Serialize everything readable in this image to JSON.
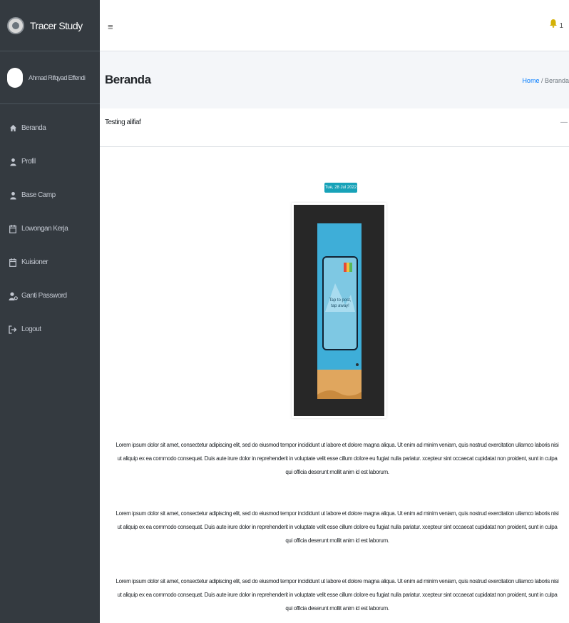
{
  "brand": {
    "name": "Tracer Study"
  },
  "user": {
    "name": "Ahmad Rifqyad Effendi"
  },
  "sidebar": {
    "items": [
      {
        "label": "Beranda",
        "icon": "home-icon"
      },
      {
        "label": "Profil",
        "icon": "user-icon"
      },
      {
        "label": "Base Camp",
        "icon": "user-icon"
      },
      {
        "label": "Lowongan Kerja",
        "icon": "calendar-icon"
      },
      {
        "label": "Kuisioner",
        "icon": "calendar-icon"
      },
      {
        "label": "Ganti Password",
        "icon": "user-cog-icon"
      },
      {
        "label": "Logout",
        "icon": "logout-icon"
      }
    ]
  },
  "topbar": {
    "menu_icon": "≡",
    "notification_count": "1"
  },
  "header": {
    "title": "Beranda",
    "breadcrumb": {
      "home": "Home",
      "separator": " / ",
      "current": "Beranda"
    }
  },
  "card": {
    "title": "Testing alifiaf",
    "collapse_symbol": "—",
    "date_badge": "Tue, 28 Jul 2022",
    "image_caption": "Tap to post, tap away!",
    "paragraphs": [
      "Lorem ipsum dolor sit amet, consectetur adipiscing elit, sed do eiusmod tempor incididunt ut labore et dolore magna aliqua. Ut enim ad minim veniam, quis nostrud exercitation ullamco laboris nisi ut aliquip ex ea commodo consequat. Duis aute irure dolor in reprehenderit in voluptate velit esse cillum dolore eu fugiat nulla pariatur. xcepteur sint occaecat cupidatat non proident, sunt in culpa qui officia deserunt mollit anim id est laborum.",
      "Lorem ipsum dolor sit amet, consectetur adipiscing elit, sed do eiusmod tempor incididunt ut labore et dolore magna aliqua. Ut enim ad minim veniam, quis nostrud exercitation ullamco laboris nisi ut aliquip ex ea commodo consequat. Duis aute irure dolor in reprehenderit in voluptate velit esse cillum dolore eu fugiat nulla pariatur. xcepteur sint occaecat cupidatat non proident, sunt in culpa qui officia deserunt mollit anim id est laborum.",
      "Lorem ipsum dolor sit amet, consectetur adipiscing elit, sed do eiusmod tempor incididunt ut labore et dolore magna aliqua. Ut enim ad minim veniam, quis nostrud exercitation ullamco laboris nisi ut aliquip ex ea commodo consequat. Duis aute irure dolor in reprehenderit in voluptate velit esse cillum dolore eu fugiat nulla pariatur. xcepteur sint occaecat cupidatat non proident, sunt in culpa qui officia deserunt mollit anim id est laborum."
    ]
  },
  "colors": {
    "sidebar_bg": "#343a40",
    "content_header_bg": "#f4f6f9",
    "badge_bg": "#17a2b8",
    "link": "#007bff",
    "bell": "#d4b106"
  }
}
